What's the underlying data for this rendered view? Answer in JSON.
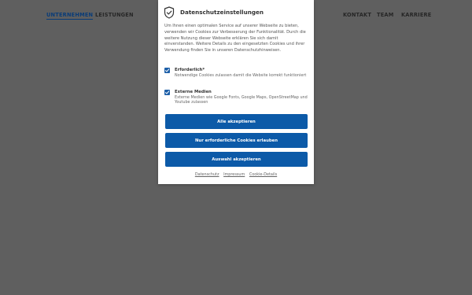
{
  "nav": {
    "left": [
      "UNTERNEHMEN",
      "LEISTUNGEN"
    ],
    "right": [
      "KONTAKT",
      "TEAM",
      "KARRIERE"
    ]
  },
  "modal": {
    "icon": "shield-check-icon",
    "title": "Datenschutzeinstellungen",
    "intro": "Um Ihnen einen optimalen Service auf unserer Webseite zu bieten, verwenden wir Cookies zur Verbesserung der Funktionalität. Durch die weitere Nutzung dieser Webseite erklären Sie sich damit einverstanden. Weitere Details zu den eingesetzten Cookies und ihrer Verwendung finden Sie in unseren Datenschutzhinweisen.",
    "options": [
      {
        "title": "Erforderlich*",
        "description": "Notwendige Cookies zulassen damit die Website korrekt funktioniert",
        "checked": true
      },
      {
        "title": "Externe Medien",
        "description": "Externe Medien wie Google Fonts, Google Maps, OpenStreetMap und Youtube zulassen",
        "checked": true
      }
    ],
    "buttons": {
      "accept_all": "Alle akzeptieren",
      "necessary_only": "Nur erforderliche Cookies erlauben",
      "accept_selection": "Auswahl akzeptieren"
    },
    "links": [
      "Datenschutz",
      "Impressum",
      "Cookie-Details"
    ]
  },
  "colors": {
    "backdrop": "#5f5f5f",
    "button": "#0c5aa8",
    "checkbox": "#1d5fa8",
    "nav_active": "#0a3c78"
  }
}
